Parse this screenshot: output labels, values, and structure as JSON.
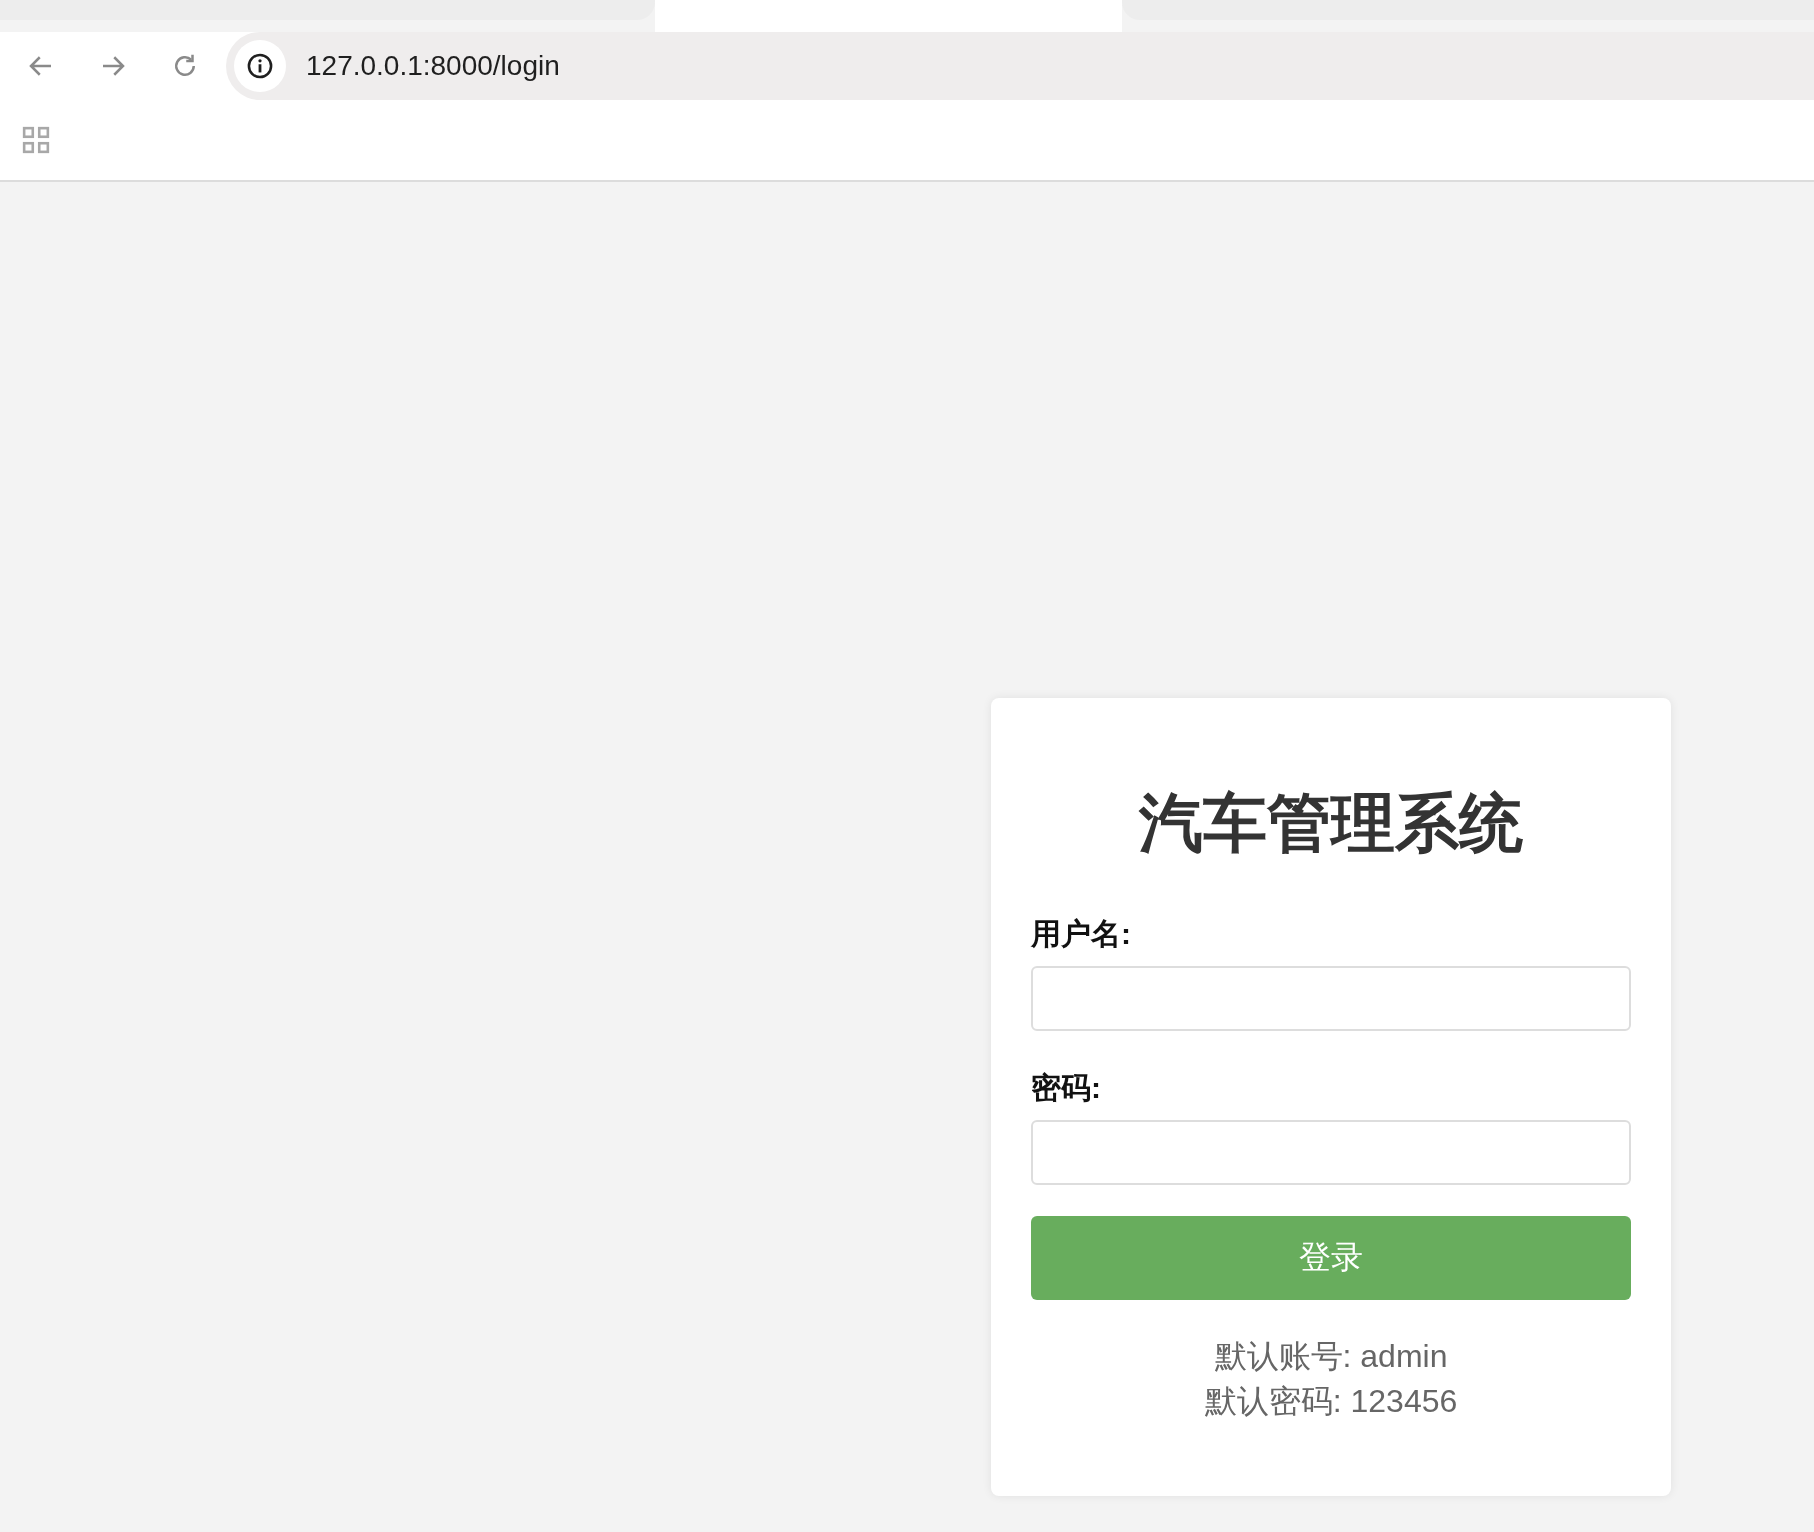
{
  "browser": {
    "url": "127.0.0.1:8000/login"
  },
  "login_card": {
    "title": "汽车管理系统",
    "fields": [
      {
        "label": "用户名:"
      },
      {
        "label": "密码:"
      }
    ],
    "submit_button": "登录",
    "hints": [
      "默认账号: admin",
      "默认密码: 123456"
    ]
  }
}
